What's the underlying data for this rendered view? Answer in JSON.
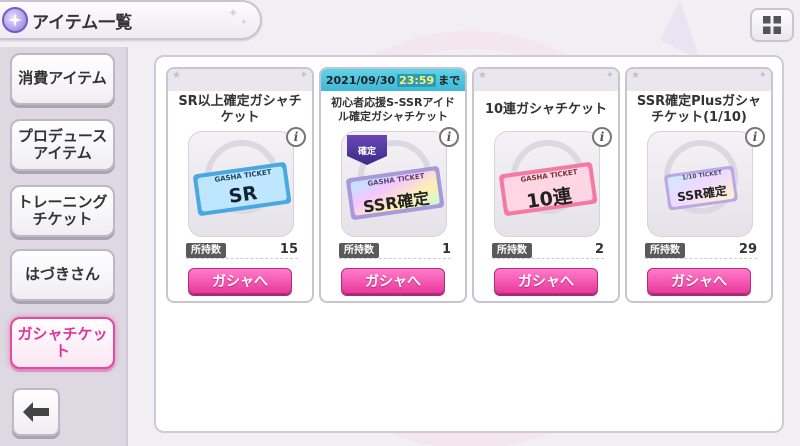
{
  "header": {
    "title": "アイテム一覧"
  },
  "sidebar": {
    "items": [
      {
        "label": "消費アイテム",
        "active": false
      },
      {
        "label": "プロデュース\nアイテム",
        "active": false
      },
      {
        "label": "トレーニング\nチケット",
        "active": false
      },
      {
        "label": "はづきさん",
        "active": false
      },
      {
        "label": "ガシャチケット",
        "active": true
      }
    ]
  },
  "cards": [
    {
      "name": "SR以上確定ガシャチケット",
      "deadline": null,
      "ticket_text": "SR",
      "ticket_header": "GASHA TICKET",
      "owned_label": "所持数",
      "owned_count": "15",
      "button_label": "ガシャへ"
    },
    {
      "name": "初心者応援S-SSRアイドル確定ガシャチケット",
      "deadline": {
        "date": "2021/09/30",
        "time": "23:59",
        "suffix": "まで"
      },
      "badge_text": "確定",
      "ticket_text": "SSR確定",
      "ticket_header": "GASHA TICKET",
      "owned_label": "所持数",
      "owned_count": "1",
      "button_label": "ガシャへ"
    },
    {
      "name": "10連ガシャチケット",
      "deadline": null,
      "ticket_text": "10連",
      "ticket_header": "GASHA TICKET",
      "owned_label": "所持数",
      "owned_count": "2",
      "button_label": "ガシャへ"
    },
    {
      "name": "SSR確定Plusガシャチケット(1/10)",
      "deadline": null,
      "ticket_text": "SSR確定",
      "ticket_header": "1/10 TICKET",
      "owned_label": "所持数",
      "owned_count": "29",
      "button_label": "ガシャへ"
    }
  ],
  "colors": {
    "accent_pink": "#e8399c",
    "active_border": "#e44aa0",
    "deadline_bg": "#3fb9d6",
    "sr_ticket": "#4aa8e0",
    "ssr_ticket": "#c8b8f0",
    "ten_ticket": "#f47aa3",
    "plus_ticket": "#d9c9f5"
  },
  "icons": {
    "header": "sparkle-orb-icon",
    "grid": "grid-icon",
    "back": "arrow-left-icon",
    "info": "info-icon"
  }
}
